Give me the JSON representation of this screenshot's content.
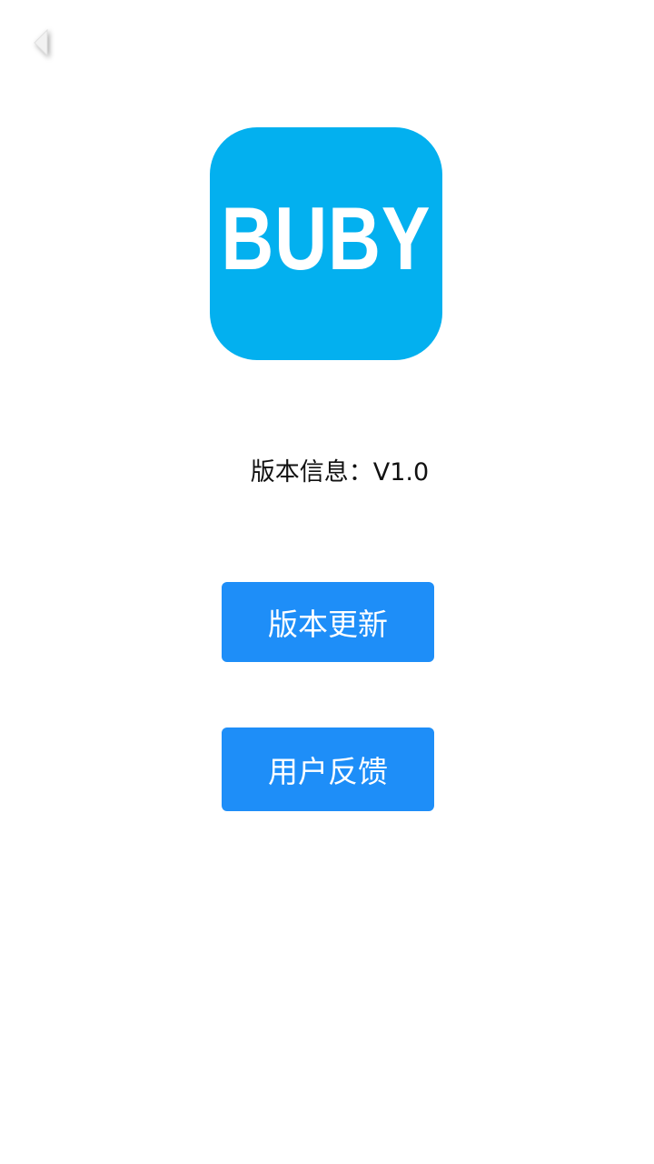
{
  "header": {
    "back_icon": "chevron-left-icon"
  },
  "logo": {
    "text": "BUBY",
    "background_color": "#03b0ef"
  },
  "version": {
    "label": "版本信息：",
    "value": "V1.0"
  },
  "buttons": {
    "update_label": "版本更新",
    "feedback_label": "用户反馈",
    "color": "#1e8ef8"
  }
}
